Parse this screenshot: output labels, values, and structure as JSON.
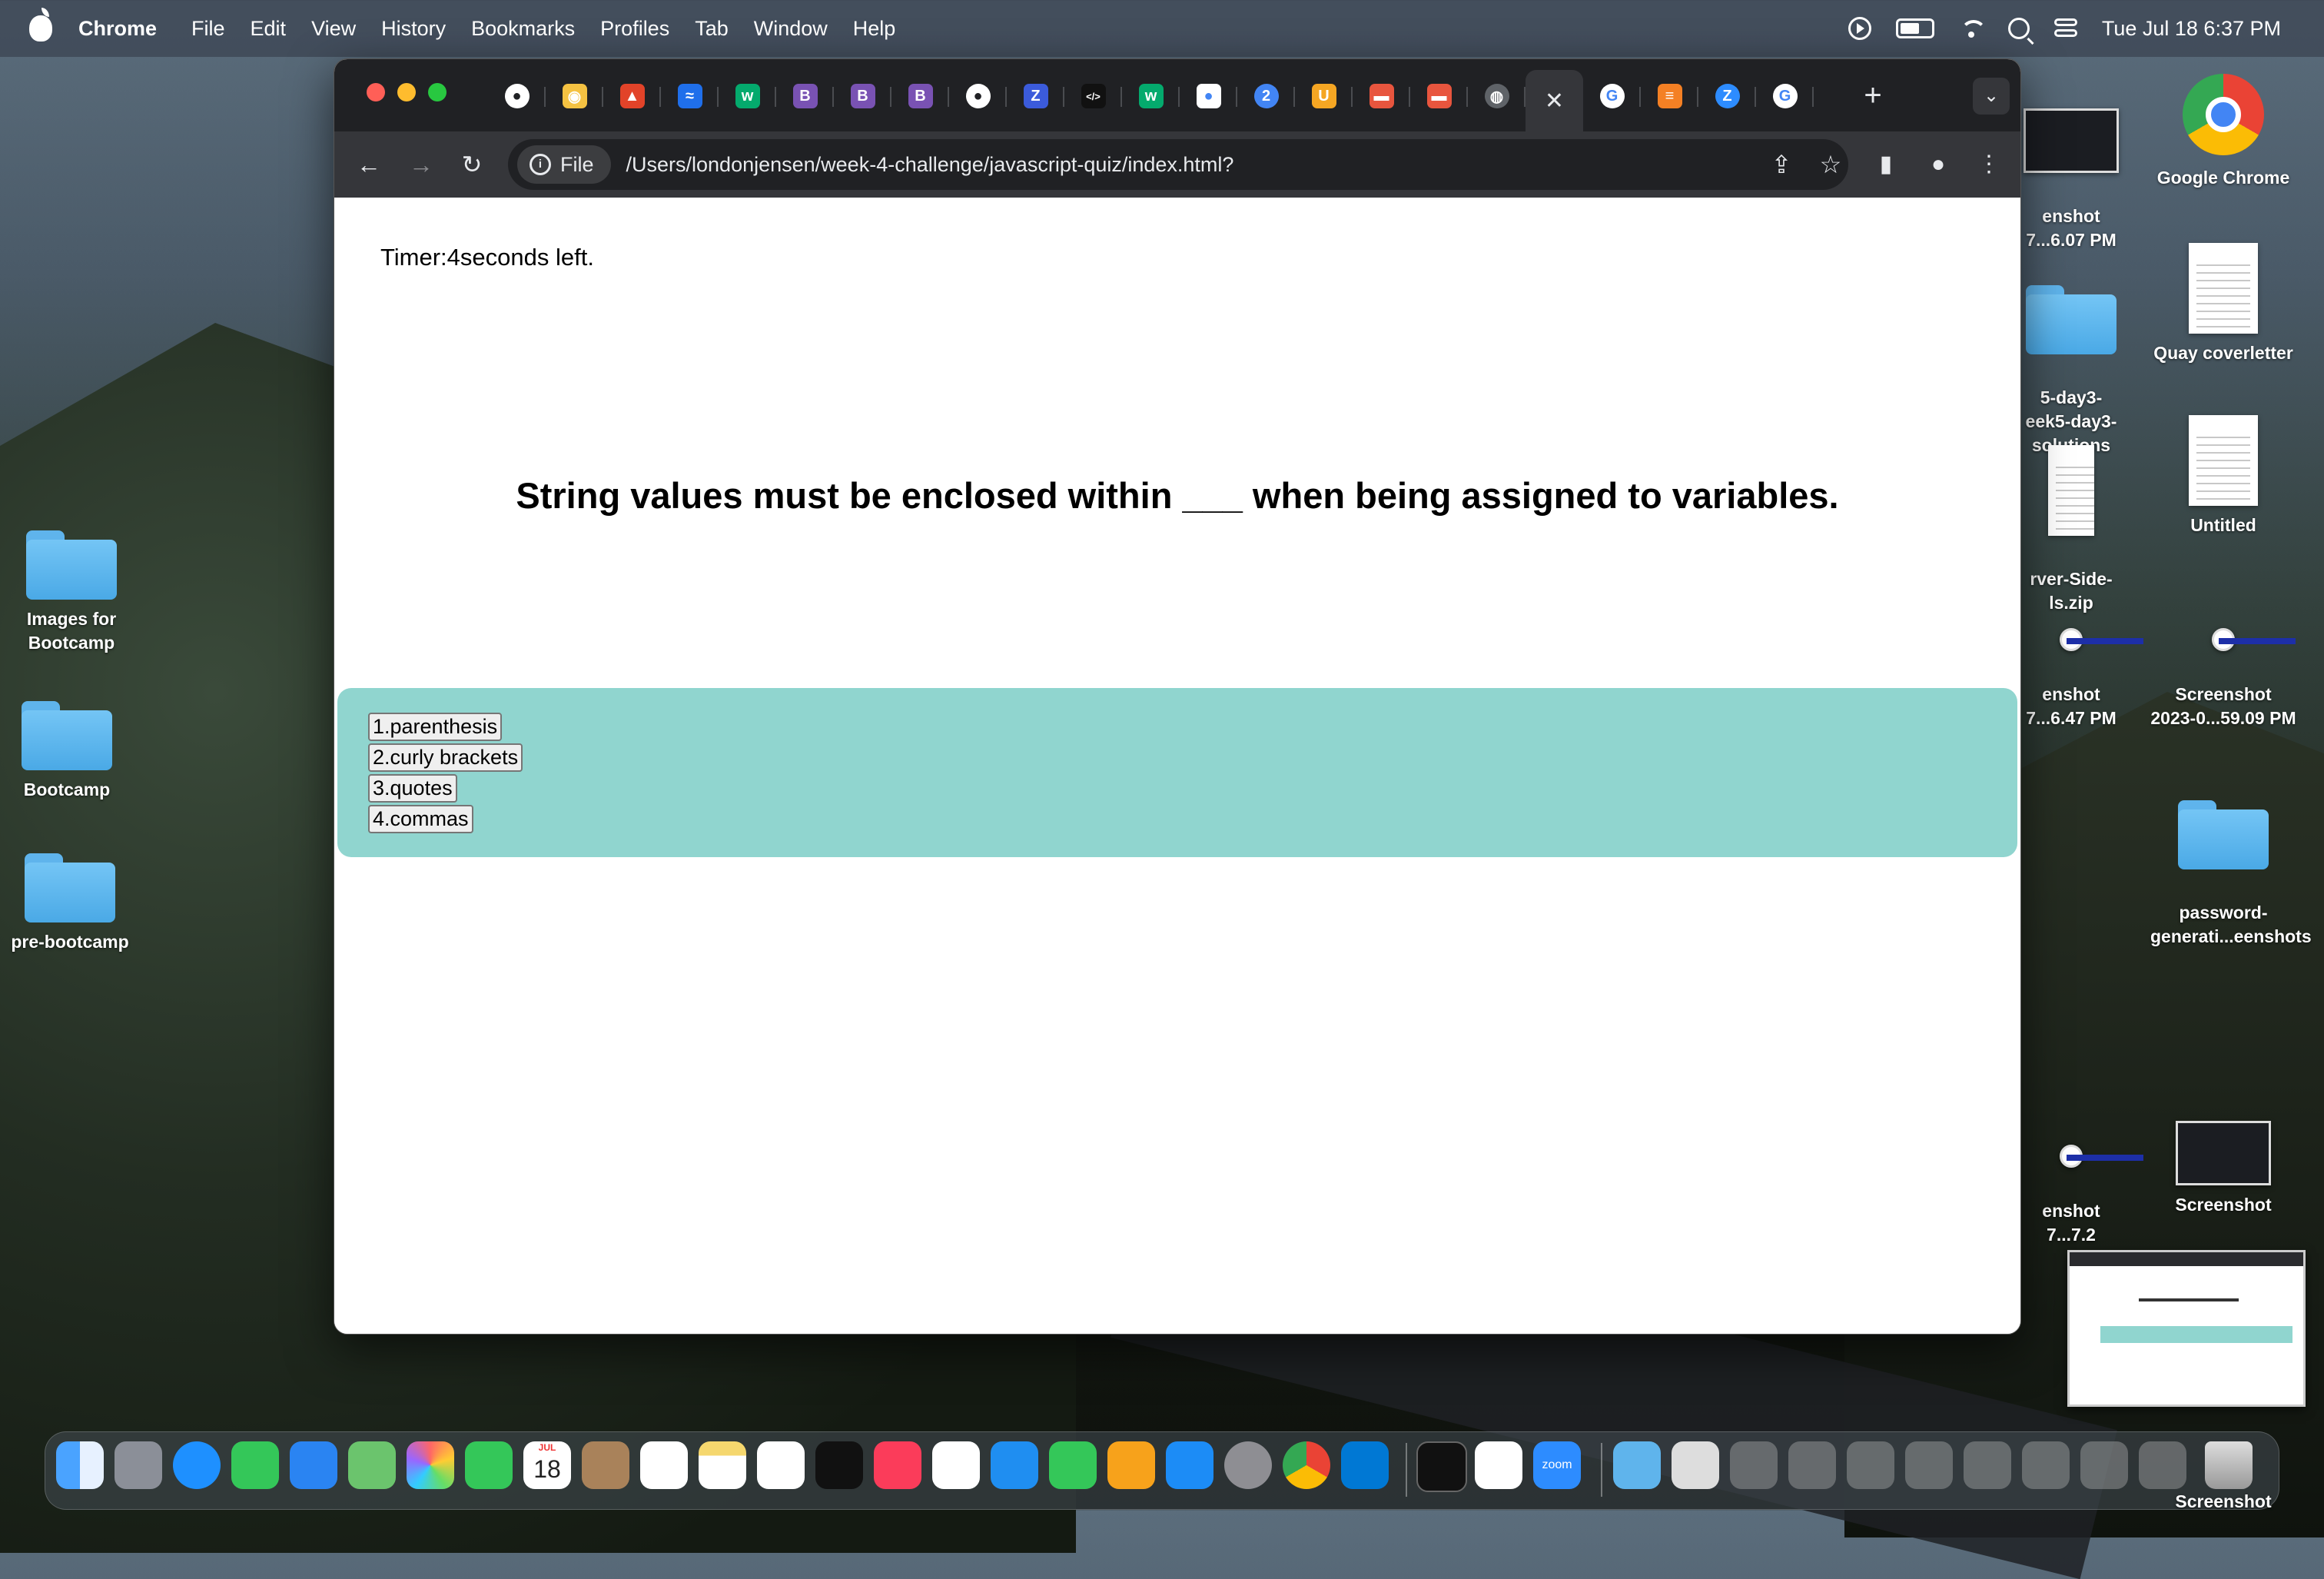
{
  "menubar": {
    "app_name": "Chrome",
    "items": [
      "File",
      "Edit",
      "View",
      "History",
      "Bookmarks",
      "Profiles",
      "Tab",
      "Window",
      "Help"
    ],
    "clock": "Tue Jul 18  6:37 PM"
  },
  "desktop": {
    "left_icons": [
      {
        "label": "Images for Bootcamp"
      },
      {
        "label": "Bootcamp"
      },
      {
        "label": "pre-bootcamp"
      }
    ],
    "right_icons": [
      {
        "label": "enshot\n7...6.07 PM"
      },
      {
        "label": "Google Chrome"
      },
      {
        "label": "5-day3-\neek5-day3-\nsolutions"
      },
      {
        "label": "Quay coverletter"
      },
      {
        "label": "rver-Side-\nls.zip"
      },
      {
        "label": "Untitled"
      },
      {
        "label": "enshot\n7...6.47 PM"
      },
      {
        "label": "Screenshot\n2023-0...59.09 PM"
      },
      {
        "label": "password-\ngenerati...eenshots"
      },
      {
        "label": "enshot\n7...7.2"
      },
      {
        "label": "Screenshot"
      },
      {
        "label": "Screenshot"
      }
    ]
  },
  "browser": {
    "tabs": [
      {
        "icon": "github-icon",
        "color": "#202124",
        "glyph": "●"
      },
      {
        "icon": "codecademy-icon",
        "color": "#f5c242",
        "glyph": "◉"
      },
      {
        "icon": "gitlab-icon",
        "color": "#e24329",
        "glyph": "▲"
      },
      {
        "icon": "mdn-icon",
        "color": "#1f6feb",
        "glyph": "≈"
      },
      {
        "icon": "w3schools-icon",
        "color": "#04aa6d",
        "glyph": "w"
      },
      {
        "icon": "bootstrap-icon",
        "color": "#7952b3",
        "glyph": "B"
      },
      {
        "icon": "bootstrap-icon",
        "color": "#7952b3",
        "glyph": "B"
      },
      {
        "icon": "bootstrap-icon",
        "color": "#7952b3",
        "glyph": "B"
      },
      {
        "icon": "github-icon",
        "color": "#202124",
        "glyph": "●"
      },
      {
        "icon": "zb-icon",
        "color": "#3b5bdb",
        "glyph": "Z"
      },
      {
        "icon": "code-icon",
        "color": "#111111",
        "glyph": "</>"
      },
      {
        "icon": "w3schools-icon",
        "color": "#04aa6d",
        "glyph": "w"
      },
      {
        "icon": "record-icon",
        "color": "#ffffff",
        "glyph": "●"
      },
      {
        "icon": "notification-icon",
        "color": "#4285f4",
        "glyph": "2"
      },
      {
        "icon": "shield-icon",
        "color": "#f5a623",
        "glyph": "U"
      },
      {
        "icon": "slides-icon",
        "color": "#e8553e",
        "glyph": "▬"
      },
      {
        "icon": "slides-icon",
        "color": "#e8553e",
        "glyph": "▬"
      },
      {
        "icon": "globe-icon",
        "color": "#5f6368",
        "glyph": "◍"
      },
      {
        "icon": "close-icon",
        "color": "#35363a",
        "glyph": "✕",
        "active": true
      },
      {
        "icon": "google-icon",
        "color": "#ffffff",
        "glyph": "G"
      },
      {
        "icon": "stackoverflow-icon",
        "color": "#f48024",
        "glyph": "≡"
      },
      {
        "icon": "zoom-icon",
        "color": "#2d8cff",
        "glyph": "Z"
      },
      {
        "icon": "google-icon",
        "color": "#ffffff",
        "glyph": "G"
      }
    ],
    "address": {
      "scheme_chip": "File",
      "url": "/Users/londonjensen/week-4-challenge/javascript-quiz/index.html?"
    }
  },
  "quiz": {
    "timer_text": "Timer:4seconds left.",
    "question": "String values must be enclosed within ___ when being assigned to variables.",
    "answers": [
      "1.parenthesis",
      "2.curly brackets",
      "3.quotes",
      "4.commas"
    ],
    "answer_band_color": "#90d5cf"
  },
  "dock": {
    "calendar_month": "JUL",
    "calendar_day": "18",
    "zoom_label": "zoom"
  }
}
